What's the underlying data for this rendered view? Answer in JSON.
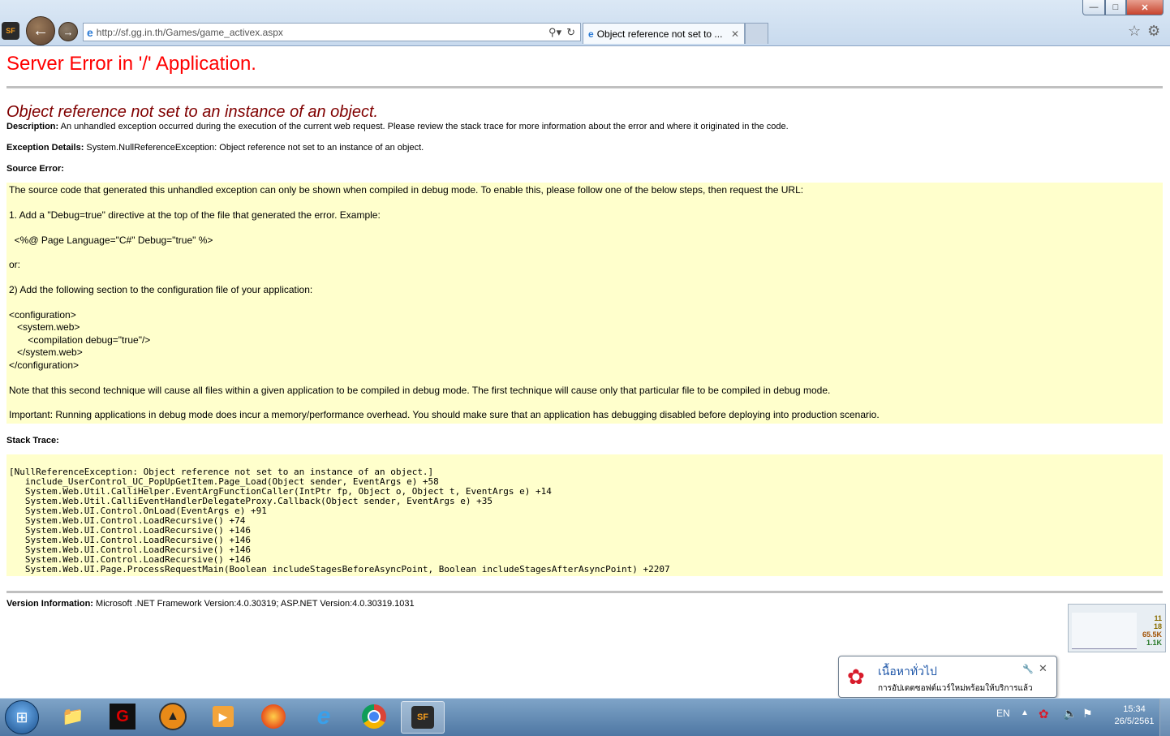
{
  "browser": {
    "url": "http://sf.gg.in.th/Games/game_activex.aspx",
    "tab_title": "Object reference not set to ...",
    "window_controls": {
      "minimize": "—",
      "maximize": "□",
      "close": "✕"
    }
  },
  "page": {
    "title": "Server Error in '/' Application.",
    "error_message": "Object reference not set to an instance of an object.",
    "description_label": "Description:",
    "description_text": "An unhandled exception occurred during the execution of the current web request. Please review the stack trace for more information about the error and where it originated in the code.",
    "exception_label": "Exception Details:",
    "exception_text": "System.NullReferenceException: Object reference not set to an instance of an object.",
    "source_error_label": "Source Error:",
    "source_error_lines": [
      "The source code that generated this unhandled exception can only be shown when compiled in debug mode. To enable this, please follow one of the below steps, then request the URL:",
      "1. Add a \"Debug=true\" directive at the top of the file that generated the error. Example:",
      "  <%@ Page Language=\"C#\" Debug=\"true\" %>",
      "or:",
      "2) Add the following section to the configuration file of your application:",
      "<configuration>\n   <system.web>\n       <compilation debug=\"true\"/>\n   </system.web>\n</configuration>",
      "Note that this second technique will cause all files within a given application to be compiled in debug mode. The first technique will cause only that particular file to be compiled in debug mode.",
      "Important: Running applications in debug mode does incur a memory/performance overhead. You should make sure that an application has debugging disabled before deploying into production scenario."
    ],
    "stack_trace_label": "Stack Trace:",
    "stack_trace": "[NullReferenceException: Object reference not set to an instance of an object.]\n   include_UserControl_UC_PopUpGetItem.Page_Load(Object sender, EventArgs e) +58\n   System.Web.Util.CalliHelper.EventArgFunctionCaller(IntPtr fp, Object o, Object t, EventArgs e) +14\n   System.Web.Util.CalliEventHandlerDelegateProxy.Callback(Object sender, EventArgs e) +35\n   System.Web.UI.Control.OnLoad(EventArgs e) +91\n   System.Web.UI.Control.LoadRecursive() +74\n   System.Web.UI.Control.LoadRecursive() +146\n   System.Web.UI.Control.LoadRecursive() +146\n   System.Web.UI.Control.LoadRecursive() +146\n   System.Web.UI.Control.LoadRecursive() +146\n   System.Web.UI.Page.ProcessRequestMain(Boolean includeStagesBeforeAsyncPoint, Boolean includeStagesAfterAsyncPoint) +2207",
    "version_label": "Version Information:",
    "version_text": "Microsoft .NET Framework Version:4.0.30319; ASP.NET Version:4.0.30319.1031"
  },
  "monitor_widget": {
    "stats": [
      "11",
      "18",
      "65.5K",
      "1.1K"
    ]
  },
  "notification": {
    "title": "เนื้อหาทั่วไป",
    "body": "การอัปเดตซอฟต์แวร์ใหม่พร้อมให้บริการแล้ว"
  },
  "taskbar": {
    "apps": [
      "explorer-icon",
      "garena-icon",
      "media-app-icon",
      "media-player-icon",
      "firefox-icon",
      "internet-explorer-icon",
      "chrome-icon",
      "sf-game-icon"
    ],
    "language": "EN",
    "time": "15:34",
    "date": "26/5/2561"
  },
  "colors": {
    "title_red": "#ff0000",
    "error_maroon": "#800000",
    "code_bg": "#ffffcc"
  }
}
